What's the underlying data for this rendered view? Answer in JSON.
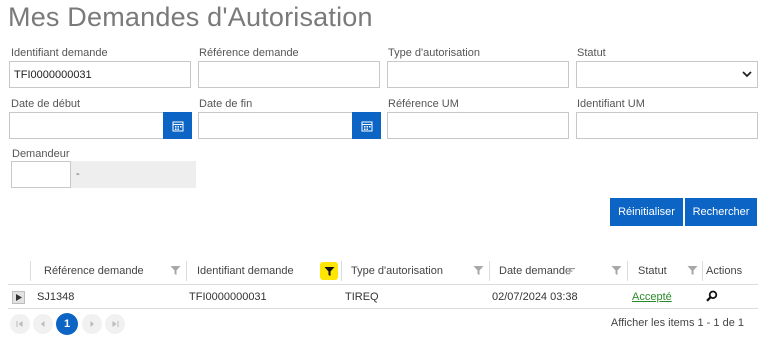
{
  "page": {
    "title": "Mes Demandes d'Autorisation"
  },
  "filters": {
    "identifiant_demande": {
      "label": "Identifiant demande",
      "value": "TFI0000000031"
    },
    "reference_demande": {
      "label": "Référence demande",
      "value": ""
    },
    "type_autorisation": {
      "label": "Type d'autorisation",
      "value": ""
    },
    "statut": {
      "label": "Statut",
      "value": ""
    },
    "date_debut": {
      "label": "Date de début",
      "value": ""
    },
    "date_fin": {
      "label": "Date de fin",
      "value": ""
    },
    "reference_um": {
      "label": "Référence UM",
      "value": ""
    },
    "identifiant_um": {
      "label": "Identifiant UM",
      "value": ""
    },
    "demandeur": {
      "label": "Demandeur",
      "prefix": "",
      "value": "-"
    }
  },
  "buttons": {
    "reset": "Réinitialiser",
    "search": "Rechercher"
  },
  "grid": {
    "columns": {
      "reference": "Référence demande",
      "identifiant": "Identifiant demande",
      "type": "Type d'autorisation",
      "date": "Date demande",
      "statut": "Statut",
      "actions": "Actions"
    },
    "rows": [
      {
        "reference": "SJ1348",
        "identifiant": "TFI0000000031",
        "type": "TIREQ",
        "date": "02/07/2024 03:38",
        "statut": "Accepté"
      }
    ]
  },
  "pager": {
    "current": "1",
    "info": "Afficher les items 1 - 1 de 1"
  },
  "colors": {
    "primary": "#0c64c5",
    "active_filter": "#ffe600",
    "status_link": "#2a8a2a"
  },
  "icons": {
    "calendar": "calendar-icon",
    "filter": "filter-icon",
    "search": "magnifier-icon",
    "expand": "expand-arrow-icon",
    "chevron": "chevron-down-icon",
    "sort": "sort-icon"
  }
}
